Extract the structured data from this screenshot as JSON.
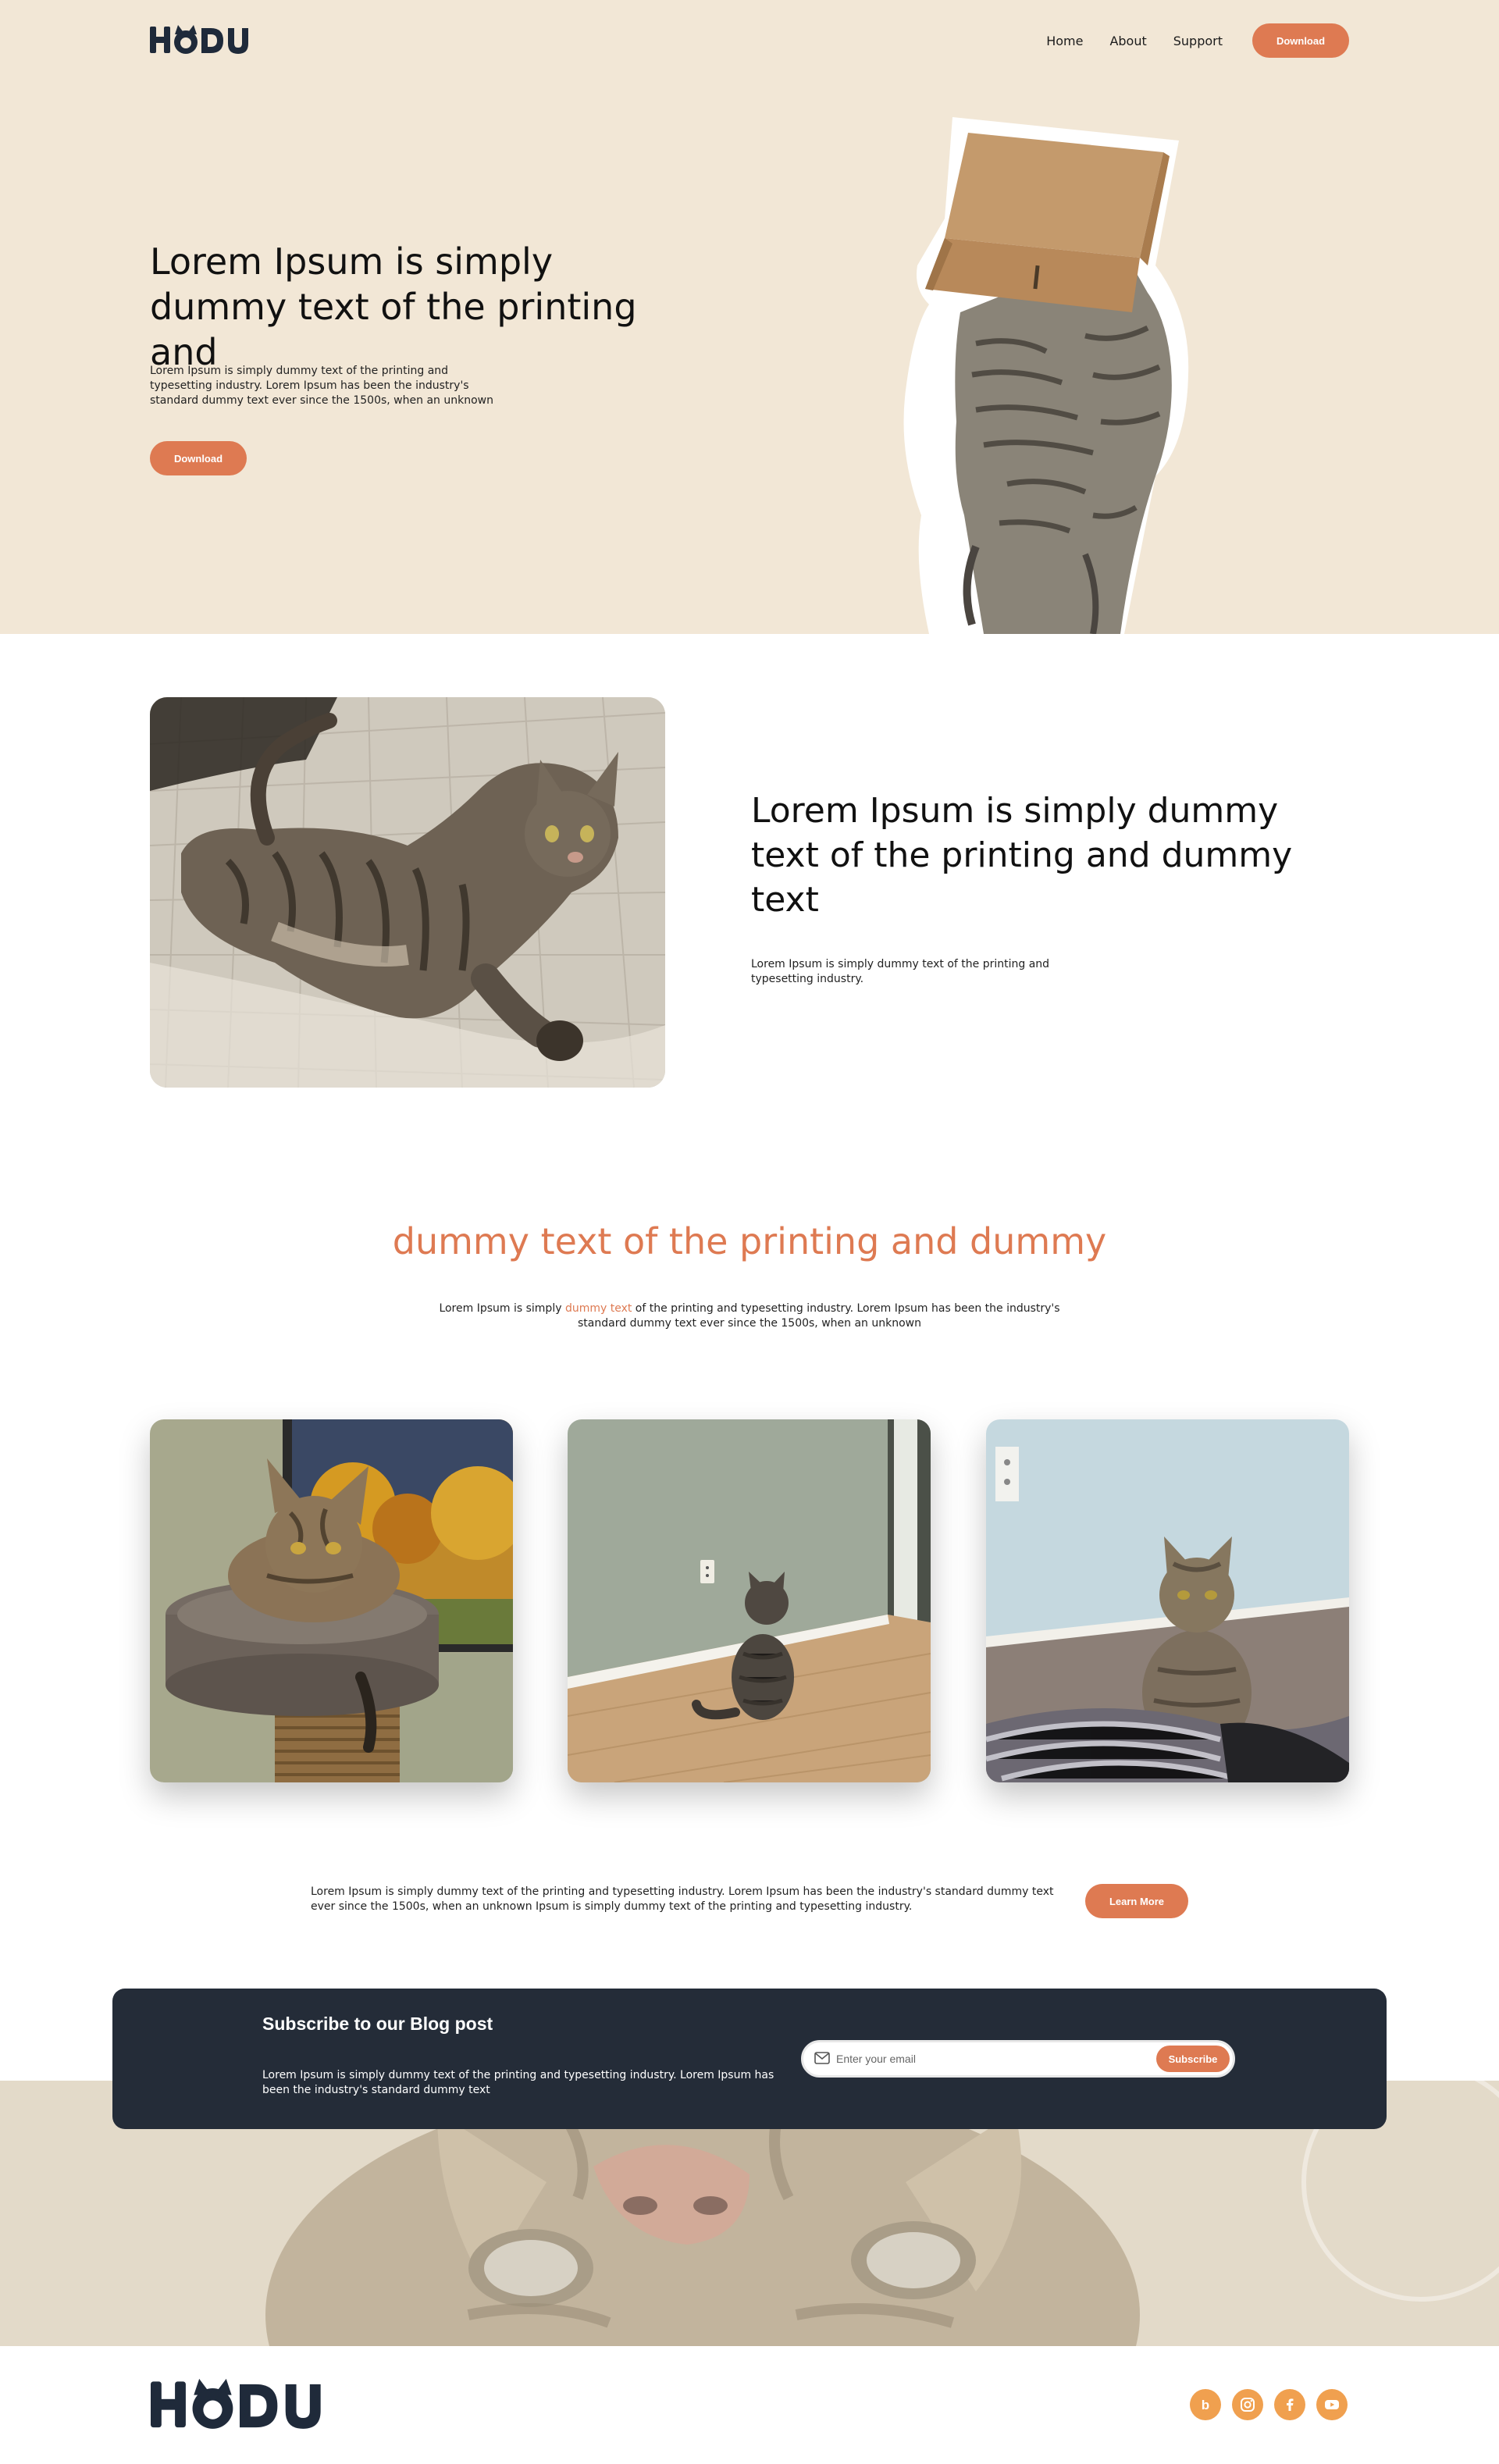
{
  "brand": {
    "logo_text": "HODU"
  },
  "nav": {
    "links": [
      "Home",
      "About",
      "Support"
    ],
    "download_label": "Download"
  },
  "hero": {
    "title": "Lorem Ipsum is simply dummy text of the printing and",
    "description": "Lorem Ipsum is simply dummy text of the printing and typesetting industry. Lorem Ipsum has been the industry's standard dummy text ever since the 1500s, when an unknown",
    "button_label": "Download",
    "image_icon": "cat-with-box-icon"
  },
  "feature": {
    "title": "Lorem Ipsum is simply dummy text of the printing and dummy text",
    "description": "Lorem Ipsum is simply dummy text of the printing and typesetting industry.",
    "image_icon": "cat-lying-on-bed-icon"
  },
  "highlight": {
    "title": "dummy text of the printing and dummy",
    "desc_before": "Lorem Ipsum is simply ",
    "desc_highlight": "dummy text",
    "desc_after": " of the printing and typesetting industry. Lorem Ipsum has been the industry's standard dummy text ever since the 1500s, when an unknown"
  },
  "gallery": {
    "images": [
      "cat-on-tower-icon",
      "cat-facing-wall-icon",
      "cat-sitting-on-blanket-icon"
    ]
  },
  "cta": {
    "text": "Lorem Ipsum is simply dummy text of the printing and typesetting industry. Lorem Ipsum has been the industry's standard dummy text ever since the 1500s, when an unknown Ipsum is simply dummy text of the printing and typesetting industry.",
    "button_label": "Learn More"
  },
  "subscribe": {
    "title": "Subscribe to our Blog post",
    "description": "Lorem Ipsum is simply dummy text of the printing and typesetting industry. Lorem Ipsum has been the industry's standard dummy text",
    "input_placeholder": "Enter your email",
    "button_label": "Subscribe"
  },
  "footer": {
    "logo_text": "HODU",
    "socials": [
      "blog-icon",
      "instagram-icon",
      "facebook-icon",
      "youtube-icon"
    ]
  },
  "colors": {
    "accent": "#de7a52",
    "hero_bg": "#f2e7d6",
    "dark": "#242c38",
    "social": "#f0a04f"
  }
}
